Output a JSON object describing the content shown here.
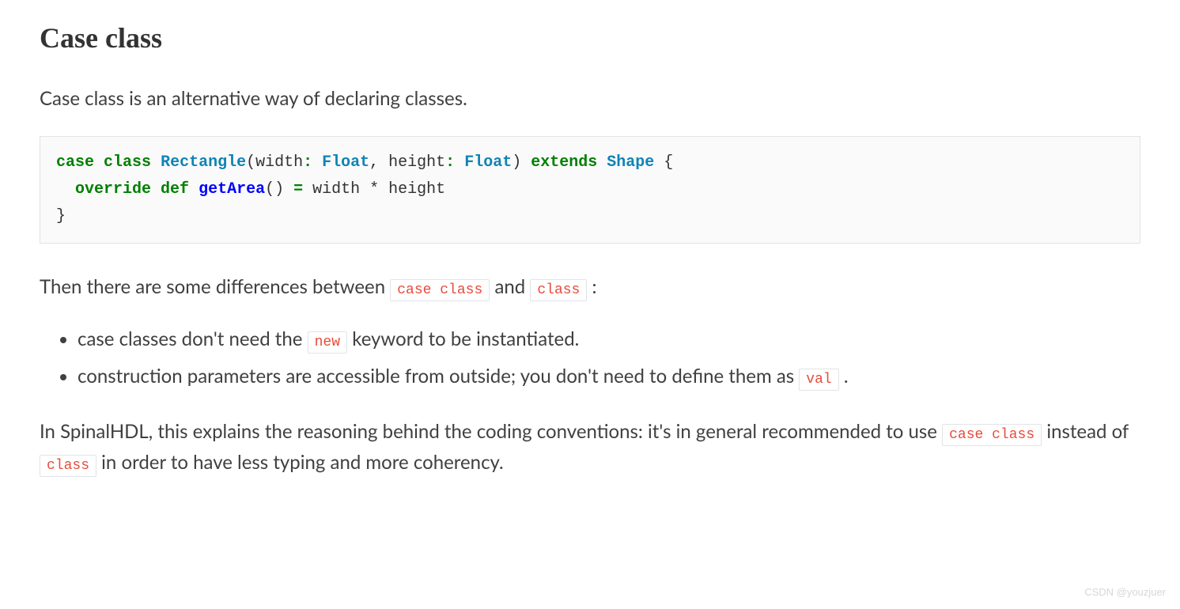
{
  "heading": "Case class",
  "intro": "Case class is an alternative way of declaring classes.",
  "code": {
    "tokens": [
      {
        "t": "case",
        "c": "k-green"
      },
      {
        "t": " ",
        "c": "plain"
      },
      {
        "t": "class",
        "c": "k-green"
      },
      {
        "t": " ",
        "c": "plain"
      },
      {
        "t": "Rectangle",
        "c": "k-name"
      },
      {
        "t": "(width",
        "c": "plain"
      },
      {
        "t": ":",
        "c": "k-green"
      },
      {
        "t": " ",
        "c": "plain"
      },
      {
        "t": "Float",
        "c": "k-type"
      },
      {
        "t": ", height",
        "c": "plain"
      },
      {
        "t": ":",
        "c": "k-green"
      },
      {
        "t": " ",
        "c": "plain"
      },
      {
        "t": "Float",
        "c": "k-type"
      },
      {
        "t": ") ",
        "c": "plain"
      },
      {
        "t": "extends",
        "c": "k-green"
      },
      {
        "t": " ",
        "c": "plain"
      },
      {
        "t": "Shape",
        "c": "k-name"
      },
      {
        "t": " {",
        "c": "plain"
      },
      {
        "t": "\n  ",
        "c": "plain"
      },
      {
        "t": "override",
        "c": "k-green"
      },
      {
        "t": " ",
        "c": "plain"
      },
      {
        "t": "def",
        "c": "k-green"
      },
      {
        "t": " ",
        "c": "plain"
      },
      {
        "t": "getArea",
        "c": "k-blue"
      },
      {
        "t": "() ",
        "c": "plain"
      },
      {
        "t": "=",
        "c": "k-green"
      },
      {
        "t": " width * height",
        "c": "plain"
      },
      {
        "t": "\n}",
        "c": "plain"
      }
    ]
  },
  "para2_a": "Then there are some differences between ",
  "para2_code1": "case class",
  "para2_b": " and ",
  "para2_code2": "class",
  "para2_c": " :",
  "bullets": [
    {
      "pre": "case classes don't need the ",
      "code": "new",
      "post": " keyword to be instantiated."
    },
    {
      "pre": "construction parameters are accessible from outside; you don't need to define them as ",
      "code": "val",
      "post": " ."
    }
  ],
  "para3_a": "In SpinalHDL, this explains the reasoning behind the coding conventions: it's in general recommended to use ",
  "para3_code1": "case class",
  "para3_b": " instead of ",
  "para3_code2": "class",
  "para3_c": " in order to have less typing and more coherency.",
  "watermark": "CSDN @youzjuer"
}
